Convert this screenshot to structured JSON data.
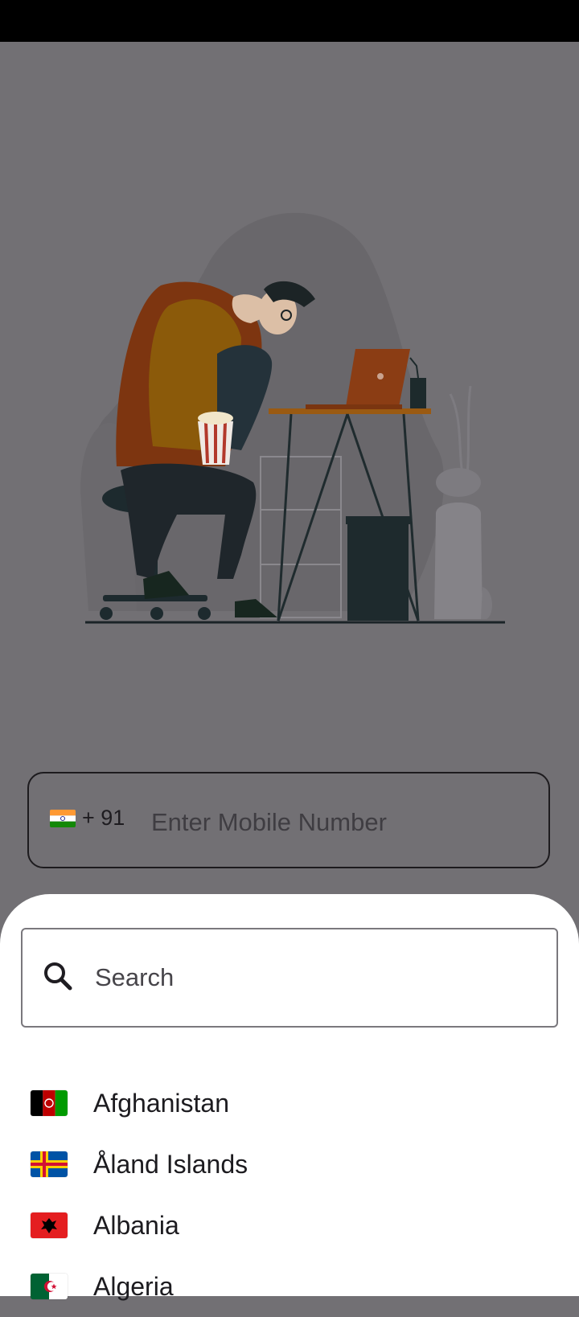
{
  "phone_field": {
    "country_flag": "india-flag-icon",
    "dial_code": "+ 91",
    "placeholder": "Enter Mobile Number"
  },
  "country_picker": {
    "search_placeholder": "Search",
    "countries": [
      {
        "name": "Afghanistan",
        "flag": "afghanistan-flag-icon"
      },
      {
        "name": "Åland Islands",
        "flag": "aland-islands-flag-icon"
      },
      {
        "name": "Albania",
        "flag": "albania-flag-icon"
      },
      {
        "name": "Algeria",
        "flag": "algeria-flag-icon"
      }
    ]
  },
  "colors": {
    "scrim": "#727074",
    "sheet": "#ffffff",
    "text": "#1c1b1f"
  }
}
